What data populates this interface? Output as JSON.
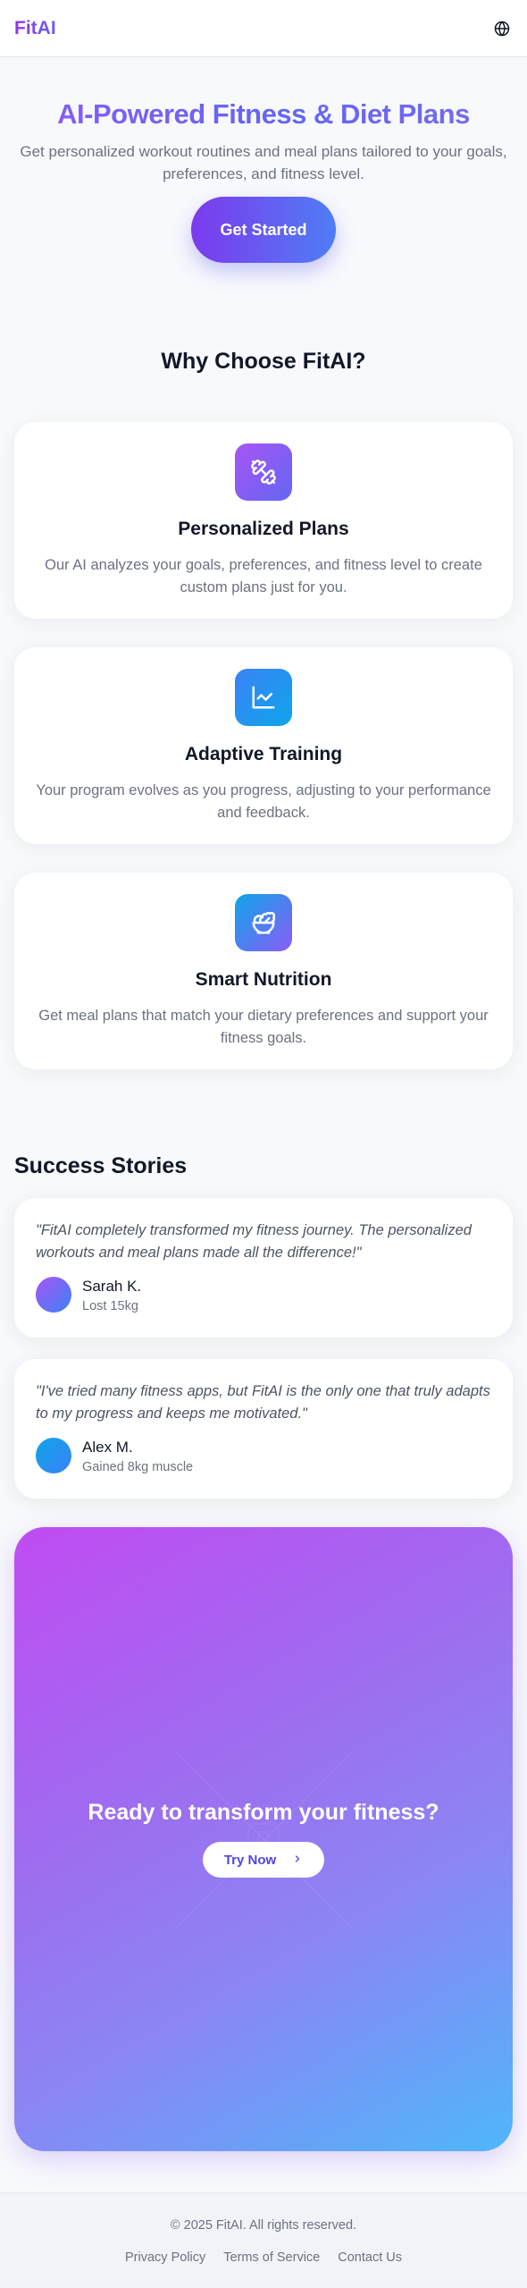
{
  "header": {
    "logo": "FitAI",
    "language_icon": "globe-icon"
  },
  "hero": {
    "title": "AI-Powered Fitness & Diet Plans",
    "subtitle": "Get personalized workout routines and meal plans tailored to your goals, preferences, and fitness level.",
    "cta_label": "Get Started"
  },
  "features": {
    "title": "Why Choose FitAI?",
    "items": [
      {
        "icon": "dumbbell-icon",
        "title": "Personalized Plans",
        "description": "Our AI analyzes your goals, preferences, and fitness level to create custom plans just for you."
      },
      {
        "icon": "chart-line-icon",
        "title": "Adaptive Training",
        "description": "Your program evolves as you progress, adjusting to your performance and feedback."
      },
      {
        "icon": "salad-bowl-icon",
        "title": "Smart Nutrition",
        "description": "Get meal plans that match your dietary preferences and support your fitness goals."
      }
    ]
  },
  "testimonials": {
    "title": "Success Stories",
    "items": [
      {
        "quote": "\"FitAI completely transformed my fitness journey. The personalized workouts and meal plans made all the difference!\"",
        "name": "Sarah K.",
        "result": "Lost 15kg"
      },
      {
        "quote": "\"I've tried many fitness apps, but FitAI is the only one that truly adapts to my progress and keeps me motivated.\"",
        "name": "Alex M.",
        "result": "Gained 8kg muscle"
      }
    ]
  },
  "cta": {
    "title": "Ready to transform your fitness?",
    "button_label": "Try Now"
  },
  "footer": {
    "copyright": "© 2025 FitAI. All rights reserved.",
    "links": [
      "Privacy Policy",
      "Terms of Service",
      "Contact Us"
    ]
  },
  "colors": {
    "brand_purple": "#8b5cf6",
    "brand_indigo": "#6366f1",
    "brand_blue": "#4fb6fb",
    "text_muted": "#6b7280"
  }
}
